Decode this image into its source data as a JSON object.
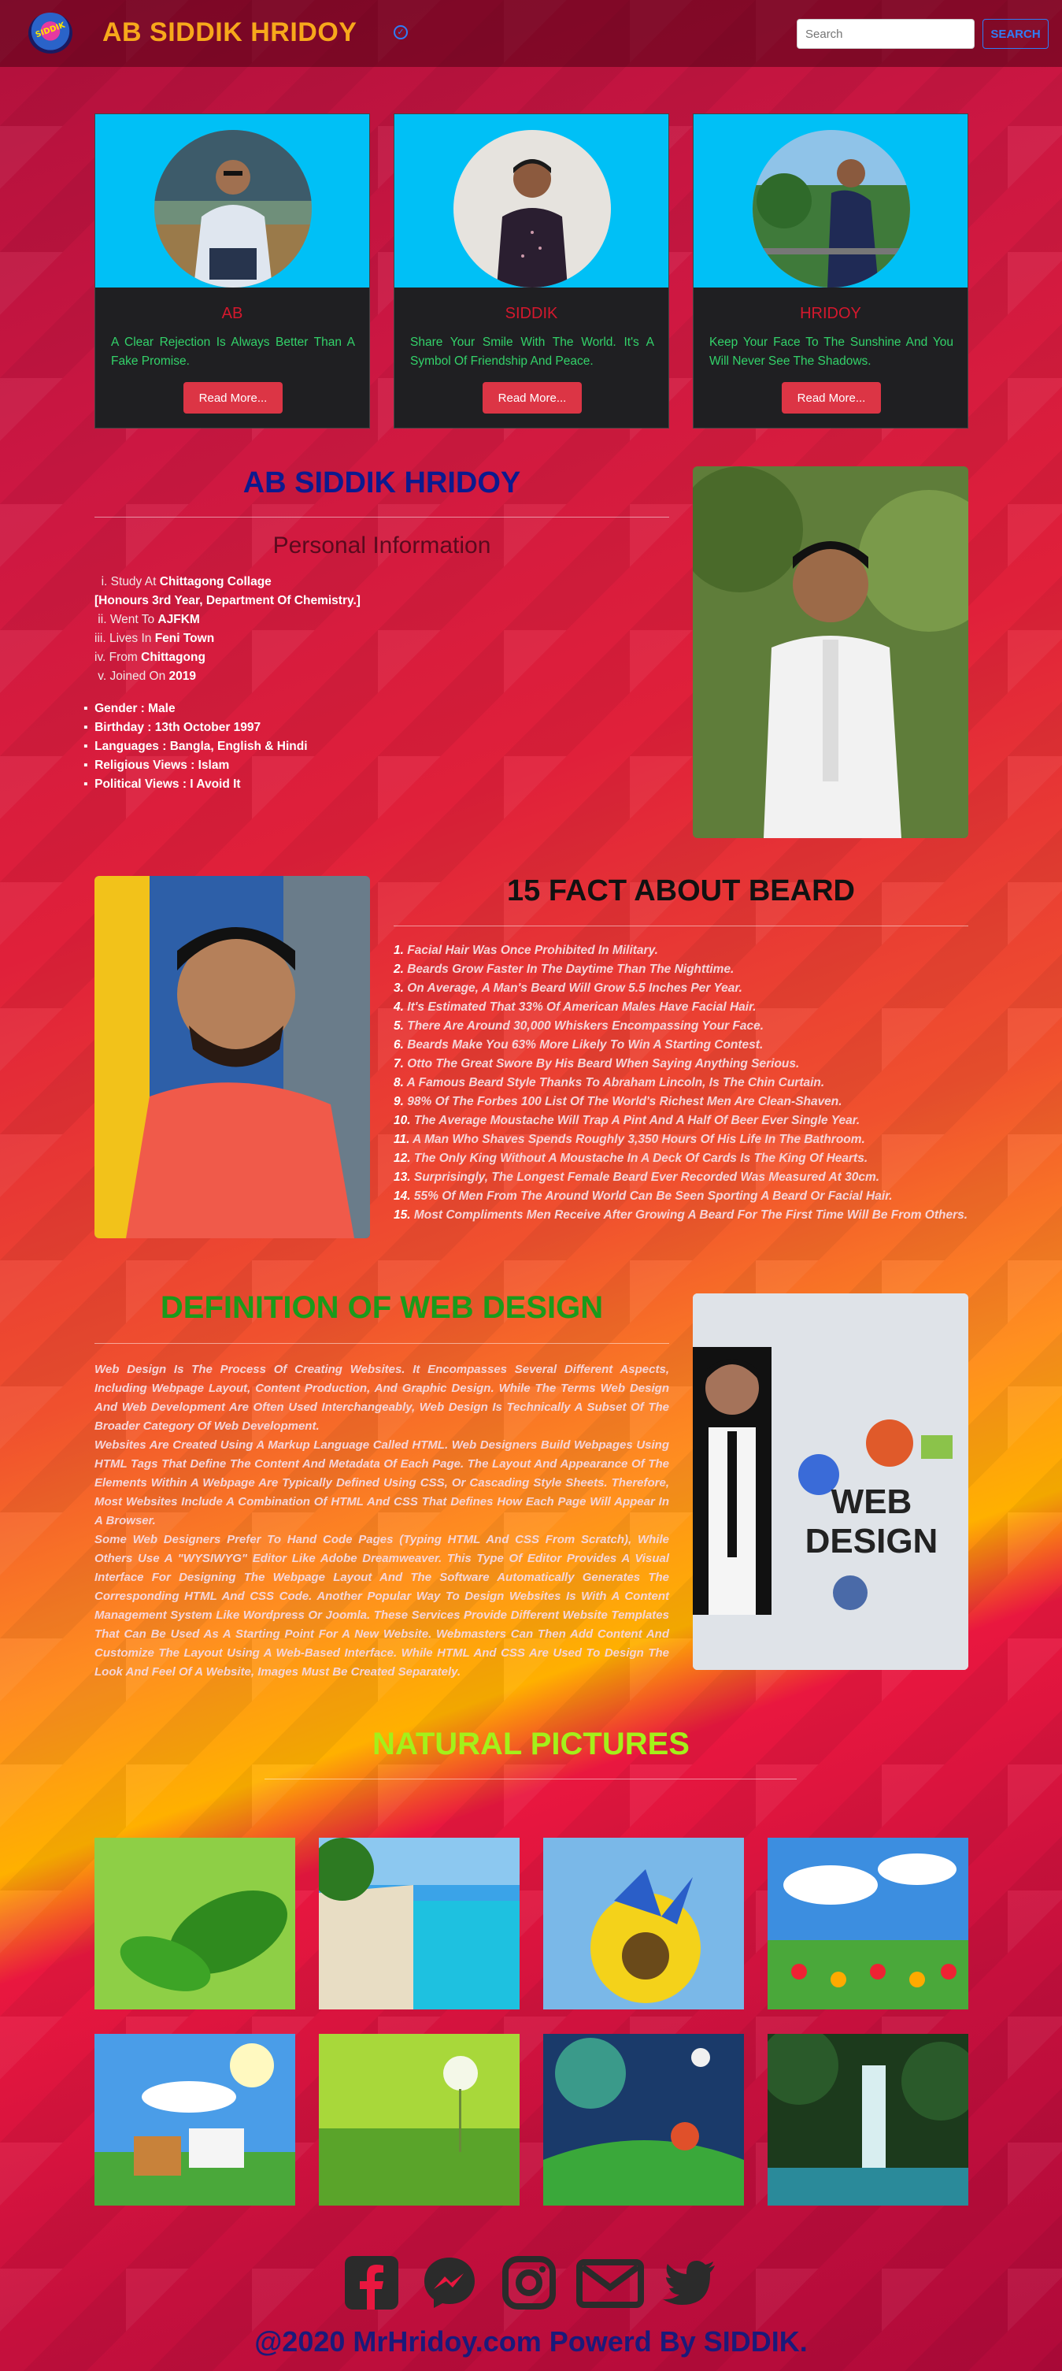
{
  "nav": {
    "logo_text": "SIDDIK",
    "brand": "AB SIDDIK HRIDOY",
    "search_placeholder": "Search",
    "search_button": "SEARCH"
  },
  "cards": [
    {
      "name": "AB",
      "text": "A Clear Rejection Is Always Better Than A Fake Promise.",
      "button": "Read More..."
    },
    {
      "name": "SIDDIK",
      "text": "Share Your Smile With The World. It's A Symbol Of Friendship And Peace.",
      "button": "Read More..."
    },
    {
      "name": "HRIDOY",
      "text": "Keep Your Face To The Sunshine And You Will Never See The Shadows.",
      "button": "Read More..."
    }
  ],
  "profile": {
    "title": "AB SIDDIK HRIDOY",
    "subtitle": "Personal Information",
    "ordered": [
      {
        "prefix": "Study At ",
        "bold": "Chittagong Collage"
      },
      {
        "prefix": "",
        "bold": "[Honours 3rd Year,  Department Of Chemistry.]"
      },
      {
        "prefix": "Went To ",
        "bold": "AJFKM"
      },
      {
        "prefix": "Lives In ",
        "bold": "Feni Town"
      },
      {
        "prefix": "From ",
        "bold": "Chittagong"
      },
      {
        "prefix": "Joined On ",
        "bold": "2019"
      }
    ],
    "bullets": [
      "Gender : Male",
      "Birthday : 13th October 1997",
      "Languages : Bangla, English & Hindi",
      "Religious Views : Islam",
      "Political Views : I Avoid It"
    ]
  },
  "beard": {
    "title": "15 FACT ABOUT BEARD",
    "facts": [
      "Facial Hair Was Once Prohibited In Military.",
      "Beards Grow Faster In The Daytime Than The Nighttime.",
      "On Average, A Man's Beard Will Grow 5.5 Inches Per Year.",
      "It's Estimated That 33% Of American Males Have Facial Hair.",
      "There Are Around 30,000 Whiskers Encompassing Your Face.",
      "Beards Make You 63% More Likely To Win A Starting Contest.",
      "Otto The Great Swore By His Beard When Saying Anything Serious.",
      "A Famous Beard Style Thanks To Abraham Lincoln, Is The Chin Curtain.",
      "98% Of The Forbes 100 List Of The World's Richest Men Are Clean-Shaven.",
      "The Average Moustache Will Trap A Pint And A Half Of Beer Ever Single Year.",
      "A Man Who Shaves Spends Roughly 3,350 Hours Of His Life In The Bathroom.",
      "The Only King Without A Moustache In A Deck Of Cards Is The King Of Hearts.",
      "Surprisingly, The Longest Female Beard Ever Recorded Was Measured At 30cm.",
      "55% Of Men From The Around World Can Be Seen Sporting A Beard Or Facial Hair.",
      "Most Compliments Men Receive After Growing A Beard For The First Time Will Be From Others."
    ]
  },
  "webdesign": {
    "title": "DEFINITION OF WEB DESIGN",
    "image_label": "WEB DESIGN",
    "paragraphs": [
      "Web Design Is The Process Of Creating Websites. It Encompasses Several Different Aspects, Including Webpage Layout, Content Production, And Graphic Design. While The Terms Web Design And Web Development Are Often Used Interchangeably, Web Design Is Technically A Subset Of The Broader Category Of Web Development.",
      "Websites Are Created Using A Markup Language Called HTML. Web Designers Build Webpages Using HTML Tags That Define The Content And Metadata Of Each Page. The Layout And Appearance Of The Elements Within A Webpage Are Typically Defined Using CSS, Or Cascading Style Sheets. Therefore, Most Websites Include A Combination Of HTML And CSS That Defines How Each Page Will Appear In A Browser.",
      "Some Web Designers Prefer To Hand Code Pages (Typing HTML And CSS From Scratch), While Others Use A \"WYSIWYG\" Editor Like Adobe Dreamweaver. This Type Of Editor Provides A Visual Interface For Designing The Webpage Layout And The Software Automatically Generates The Corresponding HTML And CSS Code. Another Popular Way To Design Websites Is With A Content Management System Like Wordpress Or Joomla. These Services Provide Different Website Templates That Can Be Used As A Starting Point For A New Website. Webmasters Can Then Add Content And Customize The Layout Using A Web-Based Interface. While HTML And CSS Are Used To Design The Look And Feel Of A Website, Images Must Be Created Separately."
    ]
  },
  "natural": {
    "title": "NATURAL PICTURES"
  },
  "social_icons": [
    "facebook-icon",
    "messenger-icon",
    "instagram-icon",
    "mail-icon",
    "twitter-icon"
  ],
  "footer": {
    "text": "@2020 MrHridoy.com Powerd By SIDDIK."
  },
  "colors": {
    "brand": "#f7a81b",
    "card_top": "#00c0f6",
    "card_name": "#d4182d",
    "card_text": "#33d26a",
    "button": "#dc3545",
    "profile_title": "#0c1a8e",
    "webdesign_title": "#1b9a1b",
    "natural_title": "#a4f01a",
    "footer": "#1b1a7a"
  }
}
